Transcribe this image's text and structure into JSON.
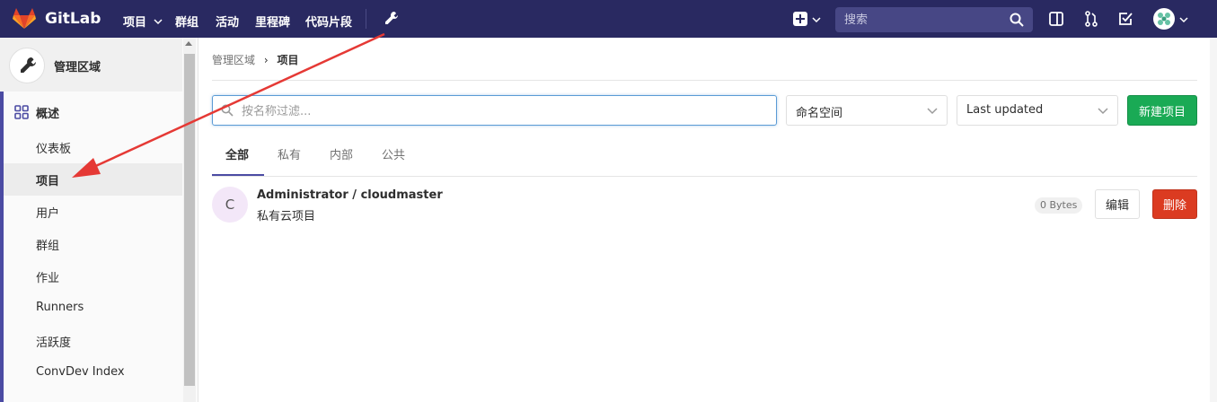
{
  "navbar": {
    "brand": "GitLab",
    "items": [
      {
        "label": "项目",
        "has_dropdown": true
      },
      {
        "label": "群组"
      },
      {
        "label": "活动"
      },
      {
        "label": "里程碑"
      },
      {
        "label": "代码片段"
      }
    ],
    "admin_icon": "wrench-icon",
    "search_placeholder": "搜索",
    "right_icons": [
      "plus-square-icon",
      "sidebar-toggle-icon",
      "merge-request-icon",
      "todo-check-icon",
      "user-avatar"
    ]
  },
  "sidebar": {
    "context_title": "管理区域",
    "context_icon": "wrench-icon",
    "section_label": "概述",
    "section_icon": "grid-icon",
    "items": [
      {
        "label": "仪表板"
      },
      {
        "label": "项目",
        "active": true
      },
      {
        "label": "用户"
      },
      {
        "label": "群组"
      },
      {
        "label": "作业"
      },
      {
        "label": "Runners"
      },
      {
        "label": "活跃度"
      },
      {
        "label": "ConvDev Index"
      }
    ]
  },
  "breadcrumb": {
    "parent": "管理区域",
    "separator": "›",
    "current": "项目"
  },
  "filters": {
    "search_placeholder": "按名称过滤...",
    "namespace_label": "命名空间",
    "sort_label": "Last updated",
    "new_project_label": "新建项目"
  },
  "tabs": [
    {
      "label": "全部",
      "active": true
    },
    {
      "label": "私有"
    },
    {
      "label": "内部"
    },
    {
      "label": "公共"
    }
  ],
  "projects": [
    {
      "avatar_letter": "C",
      "name": "Administrator / cloudmaster",
      "description": "私有云项目",
      "size": "0 Bytes",
      "edit_label": "编辑",
      "delete_label": "删除"
    }
  ],
  "colors": {
    "navbar_bg": "#292961",
    "accent": "#4b4ba3",
    "new_button": "#1aaa55",
    "delete_button": "#db3b21",
    "annotation_arrow": "#e53935"
  }
}
